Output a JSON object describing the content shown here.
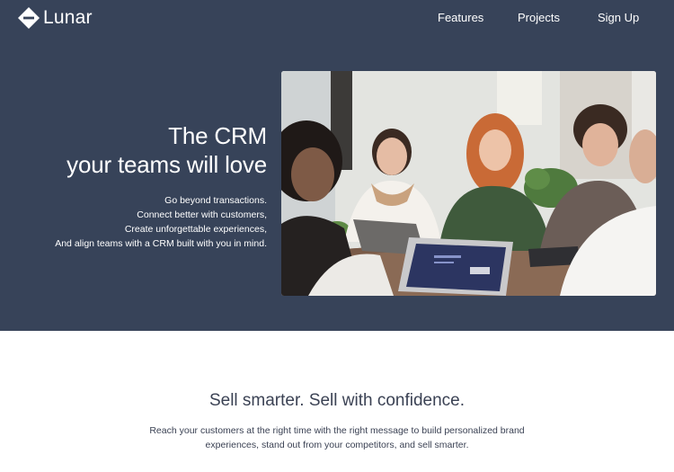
{
  "brand": {
    "name": "Lunar",
    "logo_icon": "diamond-logo-icon"
  },
  "nav": {
    "features": "Features",
    "projects": "Projects",
    "signup": "Sign Up"
  },
  "hero": {
    "title_line1": "The CRM",
    "title_line2": "your teams will love",
    "lines": [
      "Go beyond transactions.",
      "Connect better with customers,",
      "Create unforgettable experiences,",
      "And align teams with a CRM built with you in mind."
    ],
    "image": "team-meeting-photo"
  },
  "section2": {
    "title": "Sell smarter. Sell with confidence.",
    "body_line1": "Reach your customers at the right time with the right message to build personalized brand",
    "body_line2": "experiences, stand out from your competitors, and sell smarter."
  },
  "colors": {
    "hero_bg": "#374359",
    "text_light": "#ffffff",
    "text_dark": "#3b4254"
  }
}
